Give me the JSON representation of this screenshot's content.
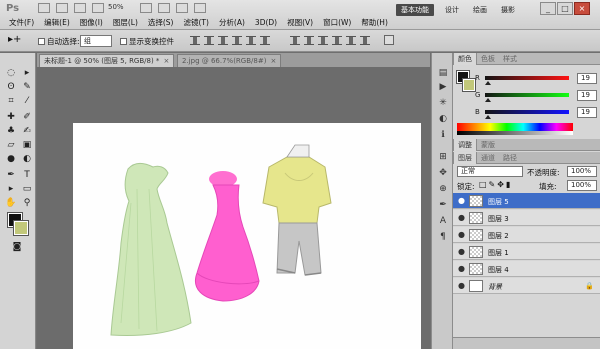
{
  "app": {
    "logo": "Ps",
    "zoom": "50%",
    "workspaces": [
      "基本功能",
      "设计",
      "绘画",
      "摄影"
    ],
    "window_buttons": [
      "_",
      "□",
      "×"
    ]
  },
  "menu": [
    "文件(F)",
    "编辑(E)",
    "图像(I)",
    "图层(L)",
    "选择(S)",
    "滤镜(T)",
    "分析(A)",
    "3D(D)",
    "视图(V)",
    "窗口(W)",
    "帮助(H)"
  ],
  "options": {
    "auto_select_label": "自动选择:",
    "auto_select_value": "组",
    "transform_label": "显示变换控件"
  },
  "tabs": [
    {
      "label": "未标题-1 @ 50% (图层 5, RGB/8) *",
      "close": "×",
      "active": true
    },
    {
      "label": "2.jpg @ 66.7%(RGB/8#)",
      "close": "×",
      "active": false
    }
  ],
  "color_panel": {
    "tabs": [
      "颜色",
      "色板",
      "样式"
    ],
    "channels": [
      {
        "label": "R",
        "value": "19"
      },
      {
        "label": "G",
        "value": "19"
      },
      {
        "label": "B",
        "value": "19"
      }
    ]
  },
  "adjust_panel": {
    "tabs": [
      "调整",
      "蒙版"
    ]
  },
  "layers_panel": {
    "tabs": [
      "图层",
      "通道",
      "路径"
    ],
    "blend_mode": "正常",
    "opacity_label": "不透明度:",
    "opacity_value": "100%",
    "lock_label": "锁定:",
    "fill_label": "填充:",
    "fill_value": "100%",
    "layers": [
      {
        "name": "图层 5",
        "selected": true
      },
      {
        "name": "图层 3",
        "selected": false
      },
      {
        "name": "图层 2",
        "selected": false
      },
      {
        "name": "图层 1",
        "selected": false
      },
      {
        "name": "图层 4",
        "selected": false
      },
      {
        "name": "背景",
        "selected": false,
        "locked": true
      }
    ]
  },
  "colors": {
    "foreground": "#111111",
    "background": "#c2c87a",
    "accent": "#3e6dc8"
  }
}
